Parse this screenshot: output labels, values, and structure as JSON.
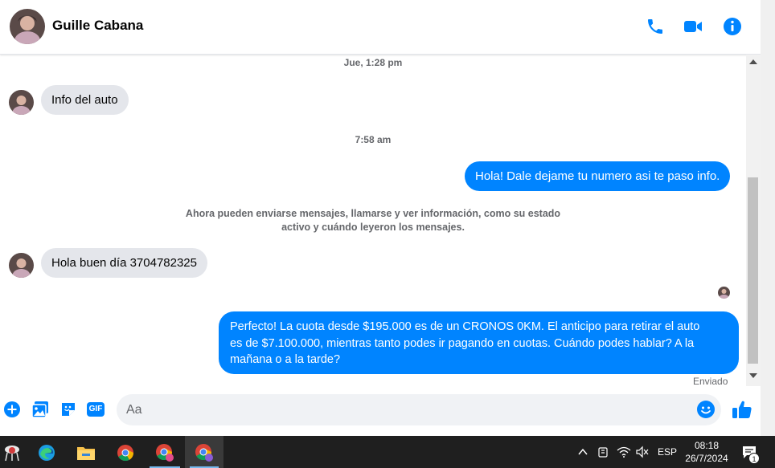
{
  "header": {
    "contact_name": "Guille Cabana",
    "icons": [
      "phone-icon",
      "video-icon",
      "info-icon"
    ],
    "accent": "#0084ff"
  },
  "chat": {
    "timestamp_1": "Jue, 1:28 pm",
    "msg_in_1": "Info del auto",
    "timestamp_2": "7:58 am",
    "msg_out_1": "Hola! Dale dejame tu numero  asi te paso info.",
    "system_line_1": "Ahora pueden enviarse mensajes, llamarse y ver información, como su estado",
    "system_line_2": "activo y cuándo leyeron los mensajes.",
    "msg_in_2": "Hola buen día 3704782325",
    "msg_out_2_line_1": "Perfecto! La cuota desde $195.000 es de un CRONOS 0KM. El anticipo para retirar el auto",
    "msg_out_2_line_2": "es de $7.100.000, mientras tanto podes ir pagando en cuotas. Cuándo podes hablar? A la",
    "msg_out_2_line_3": "mañana o a la tarde?",
    "delivery_status": "Enviado"
  },
  "composer": {
    "placeholder": "Aa",
    "gif_label": "GIF",
    "icons": [
      "plus-icon",
      "image-icon",
      "sticker-icon",
      "gif-icon",
      "emoji-icon",
      "like-icon"
    ]
  },
  "taskbar": {
    "language": "ESP",
    "time": "08:18",
    "date": "26/7/2024",
    "notification_count": "1"
  }
}
